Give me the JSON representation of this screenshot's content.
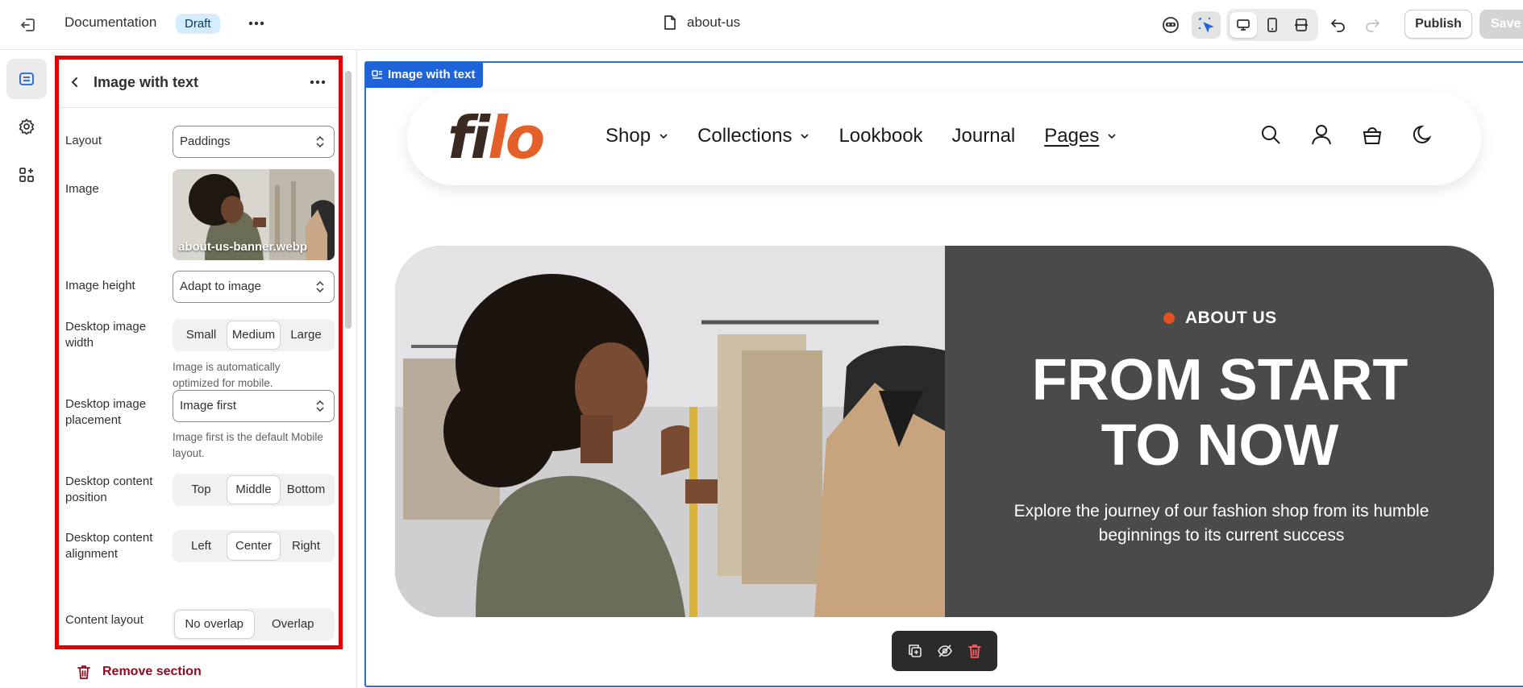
{
  "topbar": {
    "title": "Documentation",
    "badge": "Draft",
    "page_name": "about-us",
    "publish_label": "Publish",
    "save_label": "Save",
    "icons": [
      "exit-icon",
      "more-icon",
      "page-icon",
      "inspector-icon",
      "select-icon",
      "desktop-icon",
      "mobile-icon",
      "fullwidth-icon",
      "undo-icon",
      "redo-icon"
    ]
  },
  "rail": {
    "items": [
      "sections-icon",
      "settings-icon",
      "apps-icon"
    ]
  },
  "panel": {
    "title": "Image with text",
    "layout": {
      "label": "Layout",
      "value": "Paddings"
    },
    "image": {
      "label": "Image",
      "filename": "about-us-banner.webp"
    },
    "image_height": {
      "label": "Image height",
      "value": "Adapt to image"
    },
    "desktop_image_width": {
      "label": "Desktop image width",
      "options": [
        "Small",
        "Medium",
        "Large"
      ],
      "selected": "Medium",
      "help": "Image is automatically optimized for mobile."
    },
    "desktop_image_placement": {
      "label": "Desktop image placement",
      "value": "Image first",
      "help": "Image first is the default Mobile layout."
    },
    "desktop_content_position": {
      "label": "Desktop content position",
      "options": [
        "Top",
        "Middle",
        "Bottom"
      ],
      "selected": "Middle"
    },
    "desktop_content_alignment": {
      "label": "Desktop content alignment",
      "options": [
        "Left",
        "Center",
        "Right"
      ],
      "selected": "Center"
    },
    "content_layout": {
      "label": "Content layout",
      "options": [
        "No overlap",
        "Overlap"
      ],
      "selected": "No overlap"
    },
    "remove_label": "Remove section"
  },
  "preview": {
    "section_tag": "Image with text",
    "store": {
      "logo_part1": "fi",
      "logo_part2": "lo",
      "nav": [
        {
          "label": "Shop",
          "dropdown": true
        },
        {
          "label": "Collections",
          "dropdown": true
        },
        {
          "label": "Lookbook",
          "dropdown": false
        },
        {
          "label": "Journal",
          "dropdown": false
        },
        {
          "label": "Pages",
          "dropdown": true
        }
      ]
    },
    "banner": {
      "eyebrow": "ABOUT US",
      "title_line1": "FROM START",
      "title_line2": "TO NOW",
      "subtitle": "Explore the journey of our fashion shop from its humble beginnings to its current success"
    }
  },
  "colors": {
    "accent_blue": "#2c6ecb",
    "highlight_red": "#e30000",
    "logo_dark": "#3a2a22",
    "logo_orange": "#e4602b",
    "banner_bg": "#4a4a4a",
    "eyebrow_dot": "#e4501f",
    "remove_red": "#8e0b21"
  }
}
